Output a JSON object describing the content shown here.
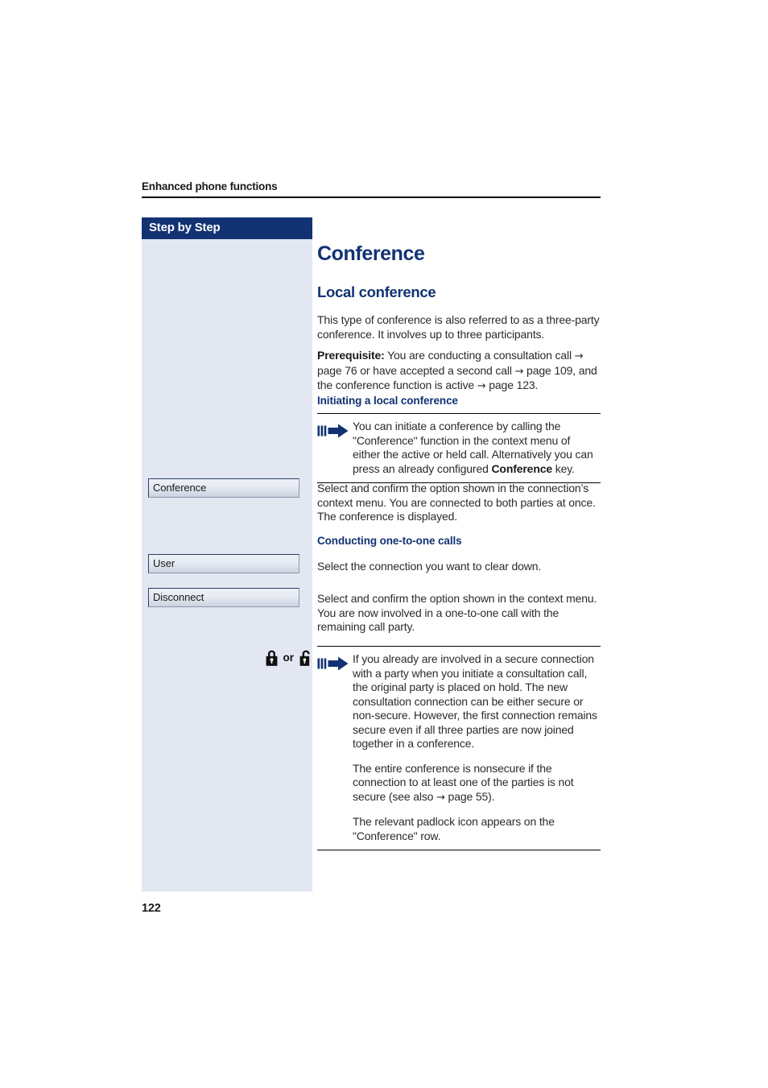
{
  "header": {
    "running_head": "Enhanced phone functions"
  },
  "sidebar": {
    "title": "Step by Step",
    "keys": [
      {
        "label": "Conference",
        "name": "key-conference"
      },
      {
        "label": "User",
        "name": "key-user"
      },
      {
        "label": "Disconnect",
        "name": "key-disconnect"
      }
    ],
    "padlock": {
      "closed_icon": "padlock-closed-icon",
      "separator": "or",
      "open_icon": "padlock-open-icon"
    }
  },
  "main": {
    "title": "Conference",
    "section_title": "Local conference",
    "intro": "This type of conference is also referred to as a three-party conference. It involves up to three participants.",
    "prerequisite_label": "Prerequisite:",
    "prerequisite_part1": " You are conducting a consultation call ",
    "prerequisite_arrow1": "→",
    "prerequisite_part2": " page 76 or have accepted a second call ",
    "prerequisite_arrow2": "→",
    "prerequisite_part3": " page 109, and the conference function is active ",
    "prerequisite_arrow3": "→",
    "prerequisite_part4": " page 123.",
    "sub_initiating": "Initiating a local conference",
    "note1_text_part1": "You can initiate a conference by calling the \"Conference\" function in the context menu of either the active or held call. Alternatively you can press an already configured ",
    "note1_bold": "Conference",
    "note1_text_part2": " key.",
    "para_select_conference": "Select and confirm the option shown in the connection’s context menu. You are connected to both parties at once. The conference is displayed.",
    "sub_one_to_one": "Conducting one-to-one calls",
    "para_select_connection": "Select the connection you want to clear down.",
    "para_select_disconnect": "Select and confirm the option shown in the context menu. You are now involved in a one-to-one call with the remaining call party.",
    "note2_para1": "If you already are involved in a secure connection with a party when you initiate a consultation call, the original party is placed on hold. The new consultation connection can be either secure or non-secure. However, the first connection remains secure even if all three parties are now joined together in a conference.",
    "note2_para2_part1": "The entire conference is nonsecure if the connection to at least one of the parties is not secure (see also ",
    "note2_para2_arrow": "→",
    "note2_para2_part2": " page 55).",
    "note2_para3": "The relevant padlock icon appears on the \"Conference\" row."
  },
  "footer": {
    "page_number": "122"
  },
  "colors": {
    "brand_navy": "#123274",
    "sidebar_bg": "#e3e7f1",
    "body_text": "#2b2b2b",
    "rule": "#000000"
  }
}
